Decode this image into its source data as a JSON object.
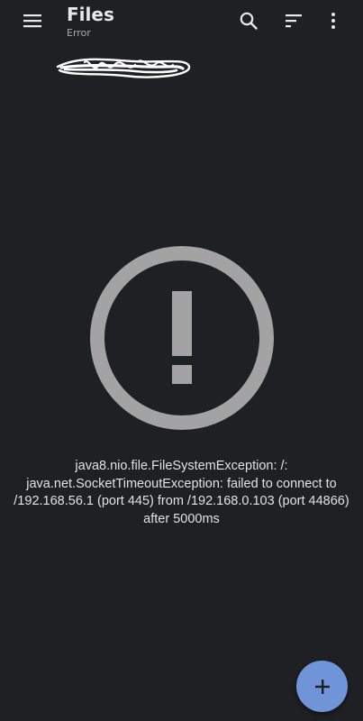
{
  "app_bar": {
    "title": "Files",
    "subtitle": "Error"
  },
  "icons": {
    "menu": "menu-icon",
    "search": "search-icon",
    "sort": "sort-icon",
    "more": "more-vert-icon",
    "error": "error-icon",
    "add": "add-icon"
  },
  "error": {
    "message": "java8.nio.file.FileSystemException: /: java.net.SocketTimeoutException: failed to connect to /192.168.56.1 (port 445) from /192.168.0.103 (port 44866) after 5000ms"
  },
  "colors": {
    "background": "#1f2024",
    "fab": "#6f94d8",
    "error_icon": "#a3a3a3"
  }
}
